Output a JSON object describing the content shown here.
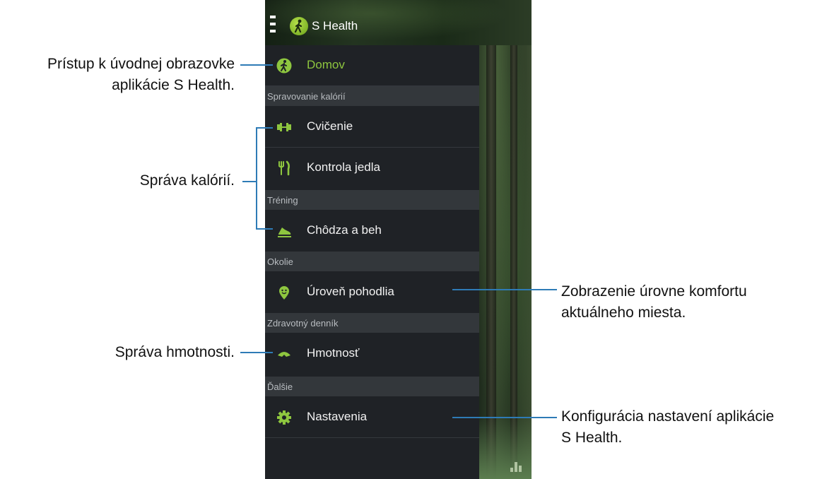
{
  "app": {
    "title": "S Health"
  },
  "menu": {
    "home": "Domov",
    "sections": {
      "calories": "Spravovanie kalórií",
      "training": "Tréning",
      "surroundings": "Okolie",
      "health_diary": "Zdravotný denník",
      "more": "Ďalšie"
    },
    "items": {
      "exercise": "Cvičenie",
      "food": "Kontrola jedla",
      "walking": "Chôdza a beh",
      "comfort": "Úroveň pohodlia",
      "weight": "Hmotnosť",
      "settings": "Nastavenia"
    }
  },
  "annotations": {
    "home_line1": "Prístup k úvodnej obrazovke",
    "home_line2": "aplikácie S Health.",
    "calories": "Správa kalórií.",
    "weight": "Správa hmotnosti.",
    "comfort_line1": "Zobrazenie úrovne komfortu",
    "comfort_line2": "aktuálneho miesta.",
    "settings_line1": "Konfigurácia nastavení aplikácie",
    "settings_line2": "S Health."
  },
  "colors": {
    "accent_green": "#8ec63f",
    "callout_blue": "#2e7bb6",
    "drawer_bg": "#1f2226",
    "section_bg": "#33373b"
  },
  "icons": {
    "home": "walking-figure-icon",
    "exercise": "dumbbell-icon",
    "food": "fork-knife-icon",
    "walking": "running-shoe-icon",
    "comfort": "smiley-pin-icon",
    "weight": "scale-icon",
    "settings": "gear-icon"
  }
}
